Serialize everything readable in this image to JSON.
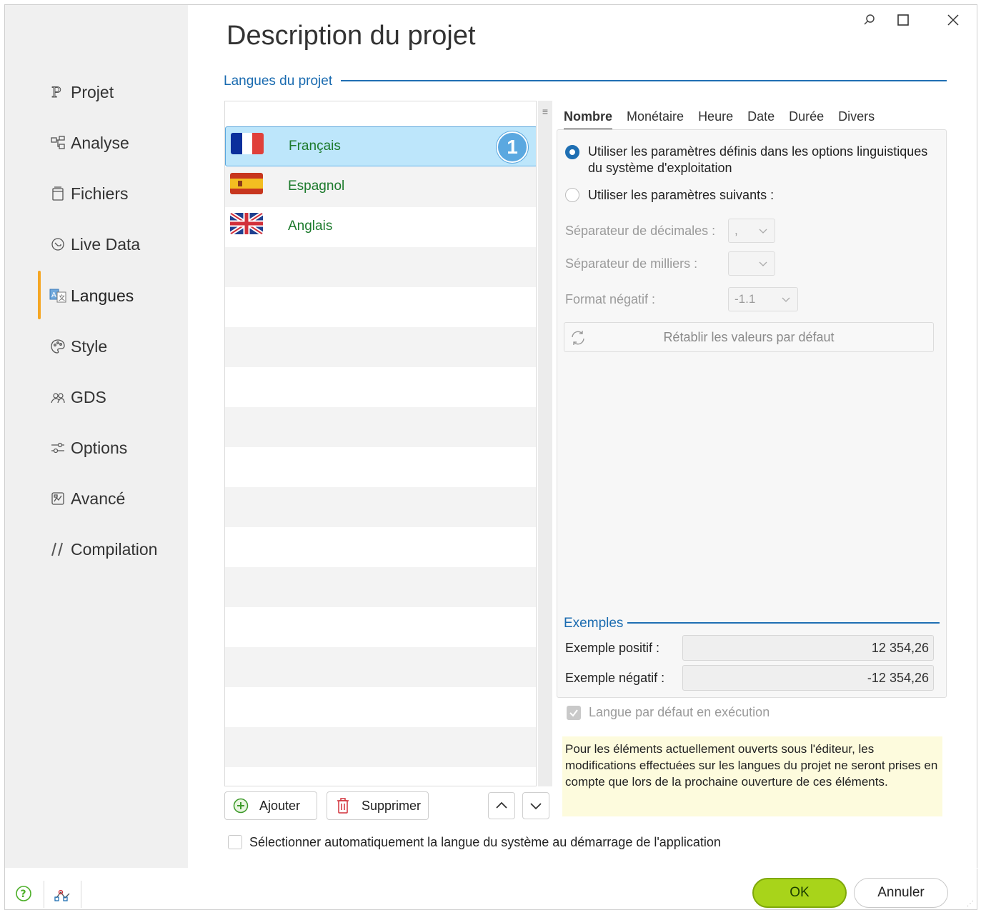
{
  "window": {
    "title": "Description du projet"
  },
  "sidebar": {
    "items": [
      {
        "label": "Projet",
        "icon": "project-icon"
      },
      {
        "label": "Analyse",
        "icon": "analysis-icon"
      },
      {
        "label": "Fichiers",
        "icon": "files-icon"
      },
      {
        "label": "Live Data",
        "icon": "live-data-icon"
      },
      {
        "label": "Langues",
        "icon": "languages-icon"
      },
      {
        "label": "Style",
        "icon": "palette-icon"
      },
      {
        "label": "GDS",
        "icon": "gds-icon"
      },
      {
        "label": "Options",
        "icon": "options-icon"
      },
      {
        "label": "Avancé",
        "icon": "advanced-icon"
      },
      {
        "label": "Compilation",
        "icon": "compilation-icon"
      }
    ],
    "active": "Langues"
  },
  "languages_section": {
    "label": "Langues du projet",
    "items": [
      {
        "name": "Français",
        "flag": "fr",
        "badge": "1"
      },
      {
        "name": "Espagnol",
        "flag": "es"
      },
      {
        "name": "Anglais",
        "flag": "uk"
      }
    ],
    "add_label": "Ajouter",
    "delete_label": "Supprimer"
  },
  "tabs": [
    "Nombre",
    "Monétaire",
    "Heure",
    "Date",
    "Durée",
    "Divers"
  ],
  "active_tab": "Nombre",
  "number_settings": {
    "option_os": "Utiliser les paramètres définis dans les options linguistiques",
    "option_os_line2": "du système d'exploitation",
    "option_custom": "Utiliser les paramètres suivants :",
    "decimal_label": "Séparateur de décimales :",
    "decimal_value": ",",
    "thousands_label": "Séparateur de milliers :",
    "thousands_value": "",
    "negative_label": "Format négatif :",
    "negative_value": "-1.1",
    "reset_label": "Rétablir les valeurs par défaut"
  },
  "examples": {
    "title": "Exemples",
    "positive_label": "Exemple positif :",
    "positive_value": "12 354,26",
    "negative_label": "Exemple négatif :",
    "negative_value": "-12 354,26"
  },
  "default_language_label": "Langue par défaut en exécution",
  "note": "Pour les éléments actuellement ouverts sous l'éditeur, les modifications effectuées sur les langues du projet ne seront prises en compte que lors de la prochaine ouverture de ces éléments.",
  "auto_select_label": "Sélectionner automatiquement la langue du système au démarrage de l'application",
  "footer": {
    "ok_label": "OK",
    "cancel_label": "Annuler"
  },
  "colors": {
    "accent": "#1f6fb3",
    "ok_green": "#a8d41a",
    "selection": "#bde6fb",
    "active_marker": "#f5a623",
    "language_text": "#1c7a2c",
    "note_bg": "#fdfbdd"
  }
}
